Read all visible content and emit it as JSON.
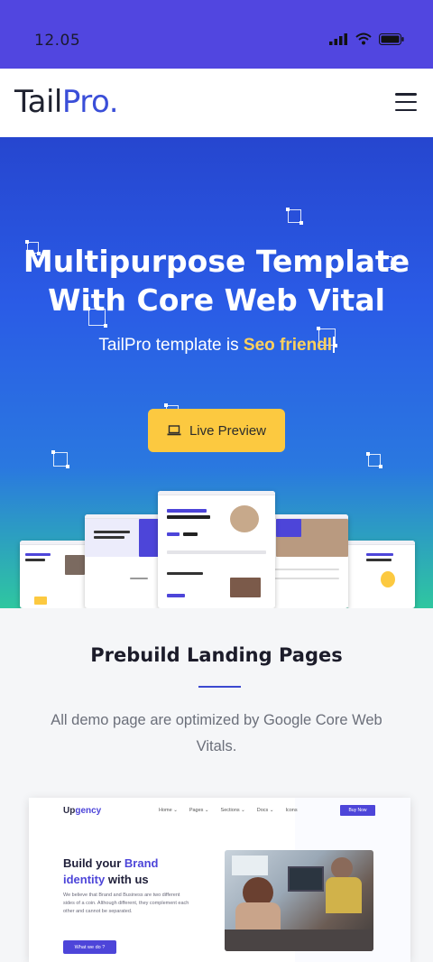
{
  "status": {
    "time": "12.05"
  },
  "header": {
    "logo_main": "Tail",
    "logo_accent": "Pro."
  },
  "hero": {
    "title_line1": "Multipurpose Template",
    "title_line2": "With Core Web Vital",
    "subtitle_prefix": "TailPro template is ",
    "subtitle_highlight": "Seo friendl",
    "cta_label": "Live Preview"
  },
  "section": {
    "title": "Prebuild Landing Pages",
    "description": "All demo page are optimized by Google Core Web Vitals."
  },
  "preview": {
    "logo_main": "Up",
    "logo_accent": "gency",
    "nav": [
      "Home ⌄",
      "Pages ⌄",
      "Sections ⌄",
      "Docs ⌄",
      "Icons"
    ],
    "buy_label": "Buy Now",
    "headline_part1": "Build your ",
    "headline_accent": "Brand",
    "headline_part2": "identity",
    "headline_part3": " with us",
    "body": "We believe that Brand and Business are two different sides of a coin. Although different, they complement each other and cannot be separated.",
    "button_label": "What we do ?"
  },
  "colors": {
    "brand": "#3a4ed8",
    "status_bar": "#5146e0",
    "cta": "#fcc940",
    "accent_purple": "#4d45d9"
  }
}
